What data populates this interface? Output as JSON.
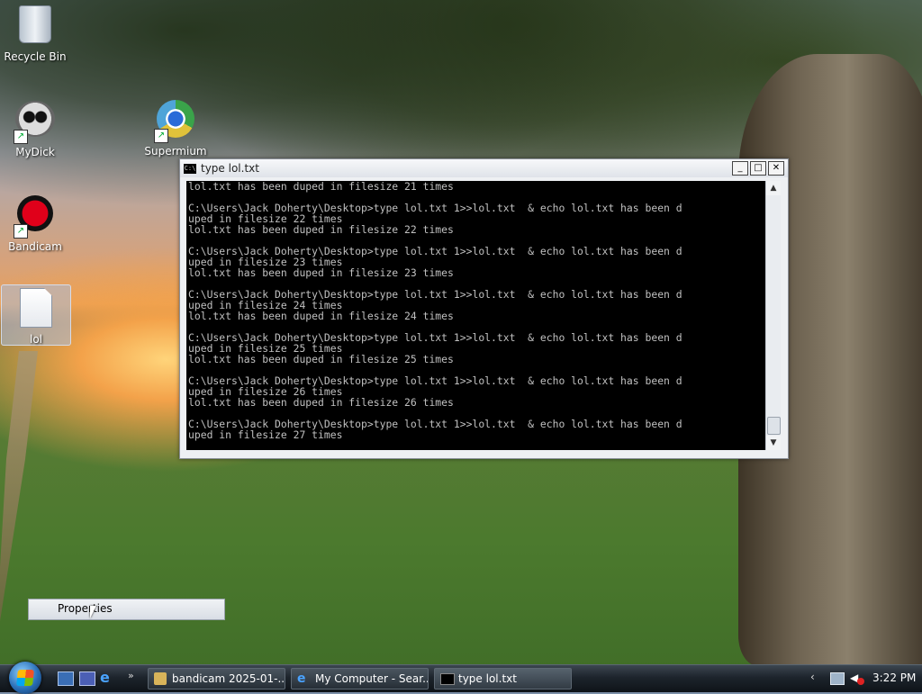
{
  "desktop": {
    "icons": [
      {
        "label": "Recycle Bin"
      },
      {
        "label": "MyDick"
      },
      {
        "label": "Supermium"
      },
      {
        "label": "Bandicam"
      },
      {
        "label": "lol"
      }
    ]
  },
  "console": {
    "title": "type  lol.txt",
    "title_icon": "C:\\",
    "buttons": {
      "minimize": "_",
      "maximize": "□",
      "close": "✕"
    },
    "lines": [
      "lol.txt has been duped in filesize 21 times",
      "",
      "C:\\Users\\Jack Doherty\\Desktop>type lol.txt 1>>lol.txt  & echo lol.txt has been d",
      "uped in filesize 22 times",
      "lol.txt has been duped in filesize 22 times",
      "",
      "C:\\Users\\Jack Doherty\\Desktop>type lol.txt 1>>lol.txt  & echo lol.txt has been d",
      "uped in filesize 23 times",
      "lol.txt has been duped in filesize 23 times",
      "",
      "C:\\Users\\Jack Doherty\\Desktop>type lol.txt 1>>lol.txt  & echo lol.txt has been d",
      "uped in filesize 24 times",
      "lol.txt has been duped in filesize 24 times",
      "",
      "C:\\Users\\Jack Doherty\\Desktop>type lol.txt 1>>lol.txt  & echo lol.txt has been d",
      "uped in filesize 25 times",
      "lol.txt has been duped in filesize 25 times",
      "",
      "C:\\Users\\Jack Doherty\\Desktop>type lol.txt 1>>lol.txt  & echo lol.txt has been d",
      "uped in filesize 26 times",
      "lol.txt has been duped in filesize 26 times",
      "",
      "C:\\Users\\Jack Doherty\\Desktop>type lol.txt 1>>lol.txt  & echo lol.txt has been d",
      "uped in filesize 27 times"
    ],
    "scroll_up": "▲",
    "scroll_down": "▼"
  },
  "context_menu": {
    "item": "Properties"
  },
  "taskbar": {
    "quick_launch_more": "»",
    "tasks": [
      {
        "label": "bandicam 2025-01-..."
      },
      {
        "label": "My Computer - Sear..."
      },
      {
        "label": "type  lol.txt"
      }
    ],
    "tray": {
      "chevron": "‹",
      "clock": "3:22 PM"
    }
  }
}
